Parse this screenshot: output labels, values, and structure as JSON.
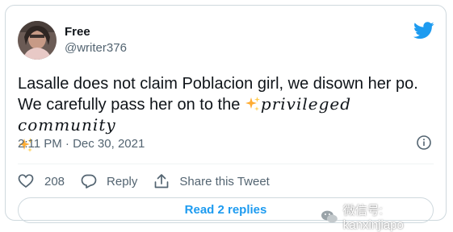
{
  "author": {
    "name": "Free",
    "handle": "@writer376"
  },
  "tweet": {
    "text_line1": "Lasalle does not claim Poblacion girl, we disown her po.",
    "text_line2_plain": "We carefully pass her on to the ",
    "text_line2_script": "privileged community",
    "timestamp": "2:11 PM · Dec 30, 2021"
  },
  "actions": {
    "like_count": "208",
    "reply_label": "Reply",
    "share_label": "Share this Tweet"
  },
  "read_replies_label": "Read 2 replies",
  "watermark": {
    "text": "微信号: kanxinjiapo"
  },
  "colors": {
    "accent": "#1d9bf0",
    "text": "#0f1419",
    "secondary": "#536471",
    "border": "#cfd9de"
  },
  "icons": [
    "twitter-bird-icon",
    "sparkles-icon",
    "info-icon",
    "heart-icon",
    "reply-icon",
    "share-icon",
    "wechat-icon"
  ]
}
